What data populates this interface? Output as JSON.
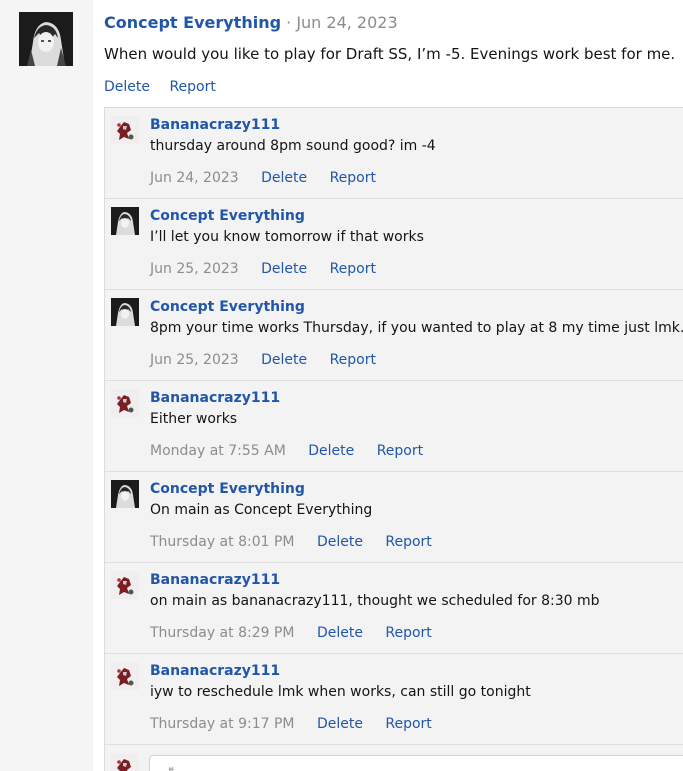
{
  "post": {
    "author": "Concept Everything",
    "separator": "·",
    "date": "Jun 24, 2023",
    "body": "When would you like to play for Draft SS, I’m -5. Evenings work best for me.",
    "actions": {
      "delete": "Delete",
      "report": "Report"
    }
  },
  "comments": [
    {
      "author": "Bananacrazy111",
      "avatar": "red-robot-avatar",
      "text": "thursday around 8pm sound good? im -4",
      "date": "Jun 24, 2023",
      "delete": "Delete",
      "report": "Report"
    },
    {
      "author": "Concept Everything",
      "avatar": "dark-anime-avatar",
      "text": "I’ll let you know tomorrow if that works",
      "date": "Jun 25, 2023",
      "delete": "Delete",
      "report": "Report"
    },
    {
      "author": "Concept Everything",
      "avatar": "dark-anime-avatar",
      "text": "8pm your time works Thursday, if you wanted to play at 8 my time just lmk.",
      "date": "Jun 25, 2023",
      "delete": "Delete",
      "report": "Report"
    },
    {
      "author": "Bananacrazy111",
      "avatar": "red-robot-avatar",
      "text": "Either works",
      "date": "Monday at 7:55 AM",
      "delete": "Delete",
      "report": "Report"
    },
    {
      "author": "Concept Everything",
      "avatar": "dark-anime-avatar",
      "text": "On main as Concept Everything",
      "date": "Thursday at 8:01 PM",
      "delete": "Delete",
      "report": "Report"
    },
    {
      "author": "Bananacrazy111",
      "avatar": "red-robot-avatar",
      "text": "on main as bananacrazy111, thought we scheduled for 8:30 mb",
      "date": "Thursday at 8:29 PM",
      "delete": "Delete",
      "report": "Report"
    },
    {
      "author": "Bananacrazy111",
      "avatar": "red-robot-avatar",
      "text": "iyw to reschedule lmk when works, can still go tonight",
      "date": "Thursday at 9:17 PM",
      "delete": "Delete",
      "report": "Report"
    }
  ],
  "reply": {
    "avatar": "red-robot-avatar",
    "icon": "quote-icon"
  },
  "colors": {
    "link": "#2156a8",
    "muted": "#8c8c8c",
    "panel": "#f3f3f3",
    "gutter": "#f5f5f5"
  }
}
